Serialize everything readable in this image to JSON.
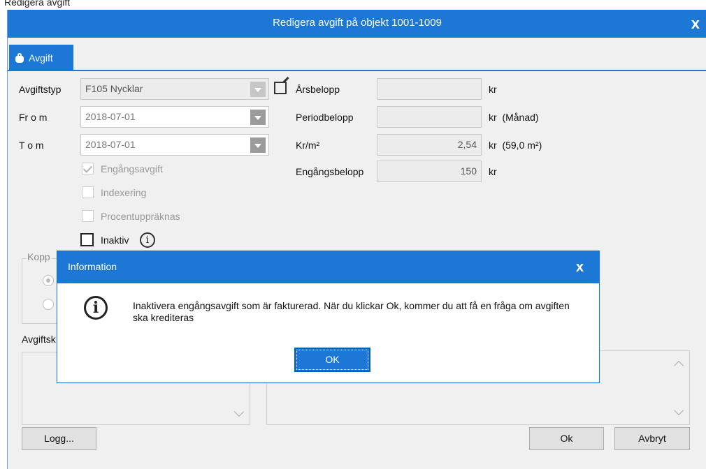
{
  "background_title": "Redigera avgift",
  "window": {
    "title": "Redigera avgift på objekt 1001-1009",
    "close_glyph": "x"
  },
  "tab": {
    "label": "Avgift",
    "icon": "moneybag-icon"
  },
  "form": {
    "avgiftstyp_label": "Avgiftstyp",
    "avgiftstyp_value": "F105  Nycklar",
    "from_label": "Fr o m",
    "from_value": "2018-07-01",
    "tom_label": "T o m",
    "tom_value": "2018-07-01",
    "engangsavgift_label": "Engångsavgift",
    "engangsavgift_checked": true,
    "indexering_label": "Indexering",
    "procent_label": "Procentuppräknas",
    "inaktiv_label": "Inaktiv",
    "arsbelopp_label": "Årsbelopp",
    "arsbelopp_value": "",
    "arsbelopp_unit": "kr",
    "periodbelopp_label": "Periodbelopp",
    "periodbelopp_value": "",
    "periodbelopp_unit": "kr  (Månad)",
    "krm2_label": "Kr/m²",
    "krm2_value": "2,54",
    "krm2_unit": "kr  (59,0 m²)",
    "engangsbelopp_label": "Engångsbelopp",
    "engangsbelopp_value": "150",
    "engangsbelopp_unit": "kr",
    "koppling_legend": "Kopp",
    "avgiftsk_label": "Avgiftsk"
  },
  "buttons": {
    "logg": "Logg...",
    "ok": "Ok",
    "avbryt": "Avbryt"
  },
  "dialog": {
    "title": "Information",
    "close_glyph": "x",
    "message": "Inaktivera engångsavgift som är fakturerad. När du klickar Ok, kommer du att få en fråga om avgiften ska krediteras",
    "ok_label": "OK",
    "icon": "info-icon"
  },
  "colors": {
    "accent": "#1c78d4",
    "window_bg": "#f0f0f0"
  }
}
